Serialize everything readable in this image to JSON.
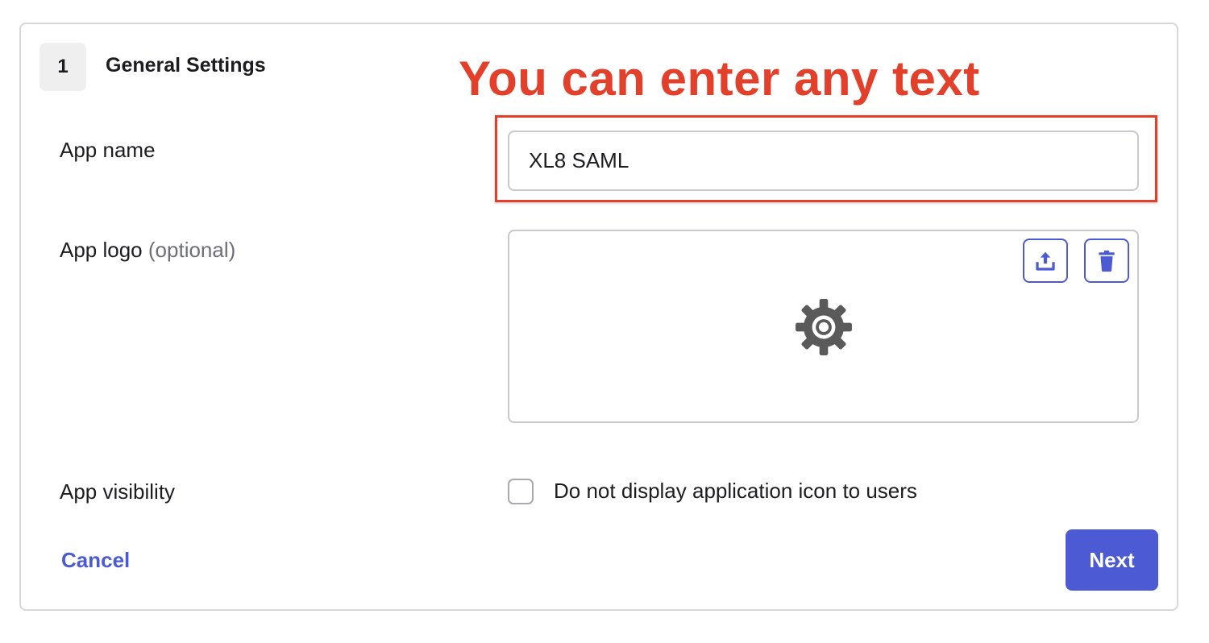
{
  "step": {
    "number": "1",
    "title": "General Settings"
  },
  "annotation": {
    "text": "You can enter any text",
    "color": "#e3402b"
  },
  "app_name": {
    "label": "App name",
    "value": "XL8 SAML"
  },
  "app_logo": {
    "label": "App logo",
    "optional": "(optional)",
    "upload_icon": "upload-icon",
    "delete_icon": "trash-icon",
    "placeholder_icon": "gear-icon"
  },
  "app_visibility": {
    "label": "App visibility",
    "checkbox_label": "Do not display application icon to users",
    "checked": false
  },
  "actions": {
    "cancel_label": "Cancel",
    "next_label": "Next"
  },
  "colors": {
    "accent": "#4c5bd4",
    "annotation": "#e3402b"
  }
}
